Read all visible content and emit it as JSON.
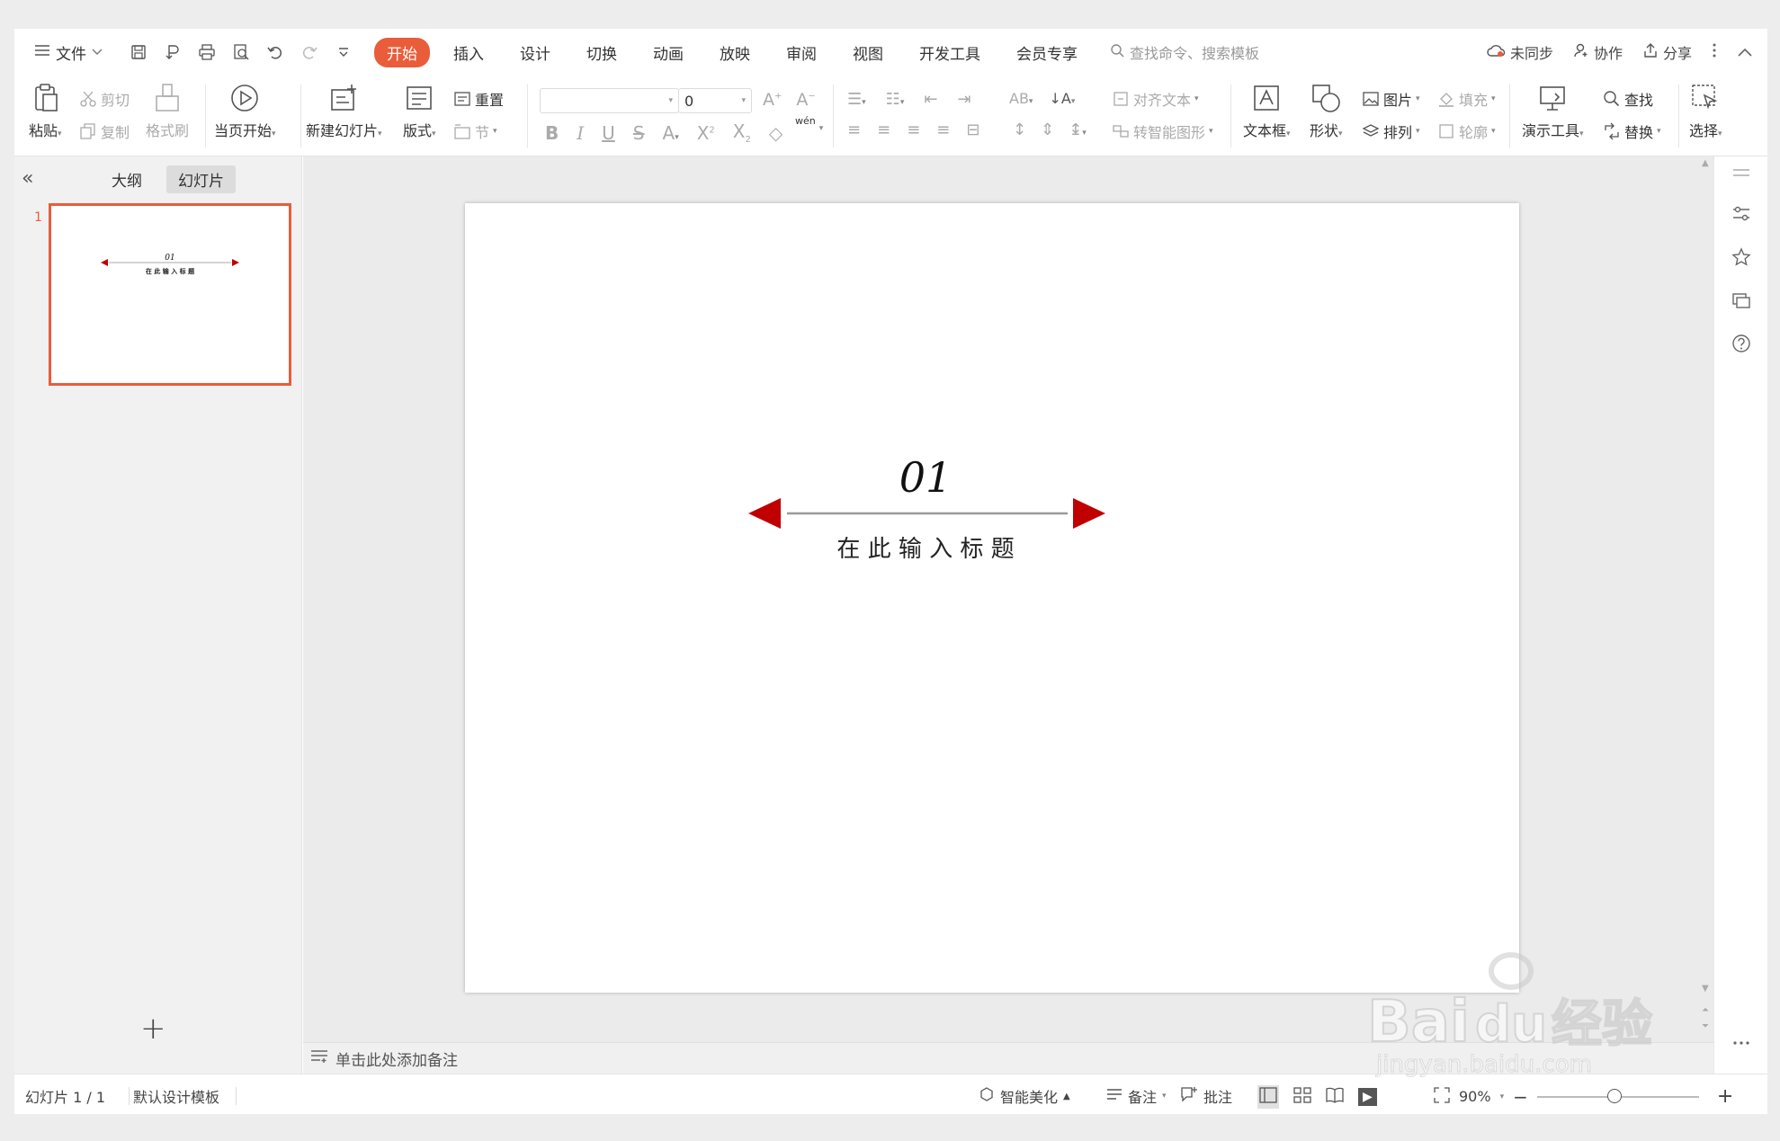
{
  "menubar": {
    "file_label": "文件",
    "tabs": [
      {
        "label": "开始",
        "active": true
      },
      {
        "label": "插入"
      },
      {
        "label": "设计"
      },
      {
        "label": "切换"
      },
      {
        "label": "动画"
      },
      {
        "label": "放映"
      },
      {
        "label": "审阅"
      },
      {
        "label": "视图"
      },
      {
        "label": "开发工具"
      },
      {
        "label": "会员专享"
      }
    ],
    "search_placeholder": "查找命令、搜索模板",
    "sync_label": "未同步",
    "collab_label": "协作",
    "share_label": "分享"
  },
  "ribbon": {
    "paste": "粘贴",
    "cut": "剪切",
    "copy": "复制",
    "format_painter": "格式刷",
    "start_from_current": "当页开始",
    "new_slide": "新建幻灯片",
    "layout": "版式",
    "reset": "重置",
    "section": "节",
    "font_size_value": "0",
    "phonetic": "wén",
    "align_text": "对齐文本",
    "convert_smartart": "转智能图形",
    "textbox": "文本框",
    "shape": "形状",
    "picture": "图片",
    "fill": "填充",
    "arrange": "排列",
    "outline": "轮廓",
    "present_tools": "演示工具",
    "find": "查找",
    "replace": "替换",
    "select": "选择"
  },
  "left_panel": {
    "tab_outline": "大纲",
    "tab_slides": "幻灯片",
    "slide_number": "1",
    "add_symbol": "+"
  },
  "slide": {
    "number": "01",
    "title": "在 此 输 入 标 题",
    "accent_color": "#c00000"
  },
  "notes": {
    "placeholder": "单击此处添加备注"
  },
  "statusbar": {
    "slide_counter": "幻灯片 1 / 1",
    "template": "默认设计模板",
    "beautify": "智能美化",
    "notes": "备注",
    "comment": "批注",
    "zoom": "90%",
    "zoom_in": "+",
    "zoom_out": "−"
  },
  "watermark": {
    "brand": "Bai",
    "brand2": "du",
    "cn": "经验",
    "url": "jingyan.baidu.com"
  },
  "colors": {
    "accent": "#e95d3b",
    "slide_red": "#c00000"
  }
}
